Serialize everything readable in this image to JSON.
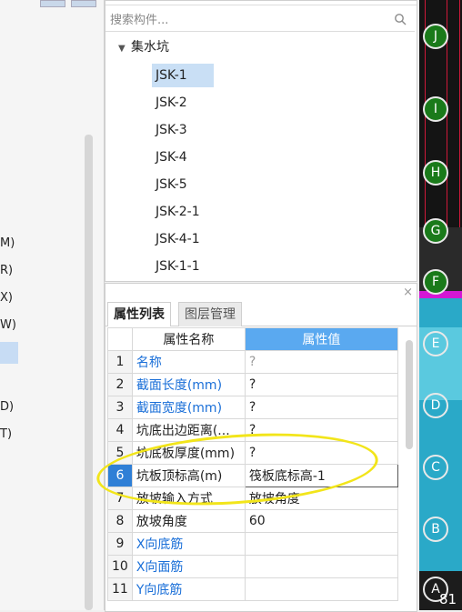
{
  "left_pane": {
    "items": [
      {
        "label": "M)"
      },
      {
        "label": "R)"
      },
      {
        "label": "X)"
      },
      {
        "label": "W)"
      },
      {
        "label": ""
      },
      {
        "label": "D)"
      },
      {
        "label": "T)"
      }
    ]
  },
  "tree": {
    "search_placeholder": "搜索构件...",
    "root_label": "集水坑",
    "items": [
      "JSK-1",
      "JSK-2",
      "JSK-3",
      "JSK-4",
      "JSK-5",
      "JSK-2-1",
      "JSK-4-1",
      "JSK-1-1"
    ],
    "selected": "JSK-1"
  },
  "properties": {
    "tabs": [
      {
        "label": "属性列表",
        "active": true
      },
      {
        "label": "图层管理",
        "active": false
      }
    ],
    "header": {
      "name": "属性名称",
      "value": "属性值"
    },
    "rows": [
      {
        "index": "1",
        "name": "名称",
        "value": "?"
      },
      {
        "index": "2",
        "name": "截面长度(mm)",
        "value": "?"
      },
      {
        "index": "3",
        "name": "截面宽度(mm)",
        "value": "?"
      },
      {
        "index": "4",
        "name": "坑底出边距离(...",
        "value": "?"
      },
      {
        "index": "5",
        "name": "坑底板厚度(mm)",
        "value": "?"
      },
      {
        "index": "6",
        "name": "坑板顶标高(m)",
        "value": "筏板底标高-1"
      },
      {
        "index": "7",
        "name": "放坡输入方式",
        "value": "放坡角度"
      },
      {
        "index": "8",
        "name": "放坡角度",
        "value": "60"
      },
      {
        "index": "9",
        "name": "X向底筋",
        "value": ""
      },
      {
        "index": "10",
        "name": "X向面筋",
        "value": ""
      },
      {
        "index": "11",
        "name": "Y向底筋",
        "value": ""
      }
    ],
    "close_glyph": "×"
  },
  "cad": {
    "axis_labels": [
      "J",
      "I",
      "H",
      "G",
      "F",
      "E",
      "D",
      "C",
      "B",
      "A"
    ],
    "corner_number": "81"
  },
  "colors": {
    "accent": "#2f7fd6",
    "header_value_bg": "#5aa9f0",
    "annotation_yellow": "#f2e51a",
    "cad_bg": "#141414"
  }
}
